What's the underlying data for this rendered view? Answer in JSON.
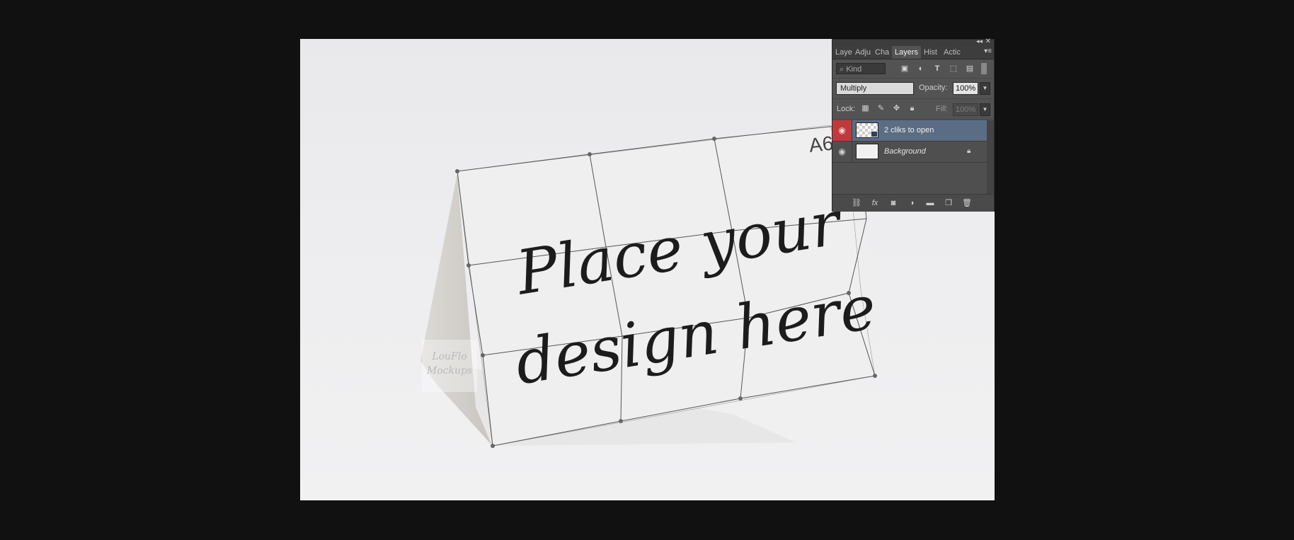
{
  "canvas": {
    "headline_line1": "Place your",
    "headline_line2": "design here",
    "size_label": "A6",
    "watermark_line1": "LouFlo",
    "watermark_line2": "Mockups"
  },
  "layers_panel": {
    "tabs": [
      {
        "label": "Laye"
      },
      {
        "label": "Adju"
      },
      {
        "label": "Cha"
      },
      {
        "label": "Layers"
      },
      {
        "label": "Hist"
      },
      {
        "label": "Actic"
      }
    ],
    "kind_filter": "⌕ Kind",
    "blend_mode": "Multiply",
    "opacity_label": "Opacity:",
    "opacity_value": "100%",
    "lock_label": "Lock:",
    "fill_label": "Fill:",
    "fill_value": "100%",
    "layers": [
      {
        "name": "2 cliks to open",
        "selected": true,
        "visible": true
      },
      {
        "name": "Background",
        "selected": false,
        "visible": true,
        "locked": true
      }
    ],
    "icons": {
      "filter": [
        "image-filter-icon",
        "adjustment-filter-icon",
        "type-filter-icon",
        "shape-filter-icon",
        "smart-object-filter-icon"
      ],
      "lock": [
        "lock-transparent-pixels-icon",
        "lock-image-pixels-icon",
        "lock-position-icon",
        "lock-all-icon"
      ],
      "footer": [
        "link-layers-icon",
        "fx-icon",
        "add-mask-icon",
        "adjustment-layer-icon",
        "new-group-icon",
        "new-layer-icon",
        "delete-layer-icon"
      ]
    },
    "colors": {
      "panel_bg": "#535353",
      "selected_layer": "#5b6c85",
      "visibility_active": "#c0393d"
    }
  }
}
